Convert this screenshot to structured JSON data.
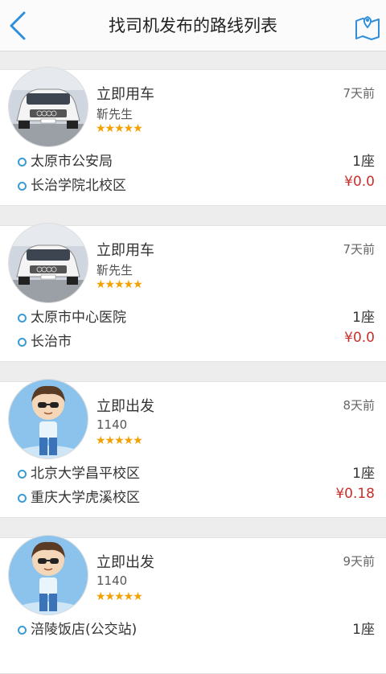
{
  "header": {
    "title": "找司机发布的路线列表",
    "back_icon": "chevron-left-icon",
    "map_icon": "map-location-icon",
    "accent": "#2f8fdc"
  },
  "colors": {
    "price": "#c9302c",
    "star": "#f3a100",
    "dot": "#3a9bd5"
  },
  "routes": [
    {
      "avatar": "car-photo",
      "status": "立即用车",
      "name": "靳先生",
      "rating": 5,
      "stars": "★★★★★",
      "time": "7天前",
      "from": "太原市公安局",
      "to": "长治学院北校区",
      "seats": "1座",
      "price": "¥0.0"
    },
    {
      "avatar": "car-photo",
      "status": "立即用车",
      "name": "靳先生",
      "rating": 5,
      "stars": "★★★★★",
      "time": "7天前",
      "from": "太原市中心医院",
      "to": "长治市",
      "seats": "1座",
      "price": "¥0.0"
    },
    {
      "avatar": "cartoon-boy",
      "status": "立即出发",
      "name": "1140",
      "rating": 5,
      "stars": "★★★★★",
      "time": "8天前",
      "from": "北京大学昌平校区",
      "to": "重庆大学虎溪校区",
      "seats": "1座",
      "price": "¥0.18"
    },
    {
      "avatar": "cartoon-boy",
      "status": "立即出发",
      "name": "1140",
      "rating": 5,
      "stars": "★★★★★",
      "time": "9天前",
      "from": "涪陵饭店(公交站)",
      "to": "",
      "seats": "1座",
      "price": ""
    }
  ]
}
